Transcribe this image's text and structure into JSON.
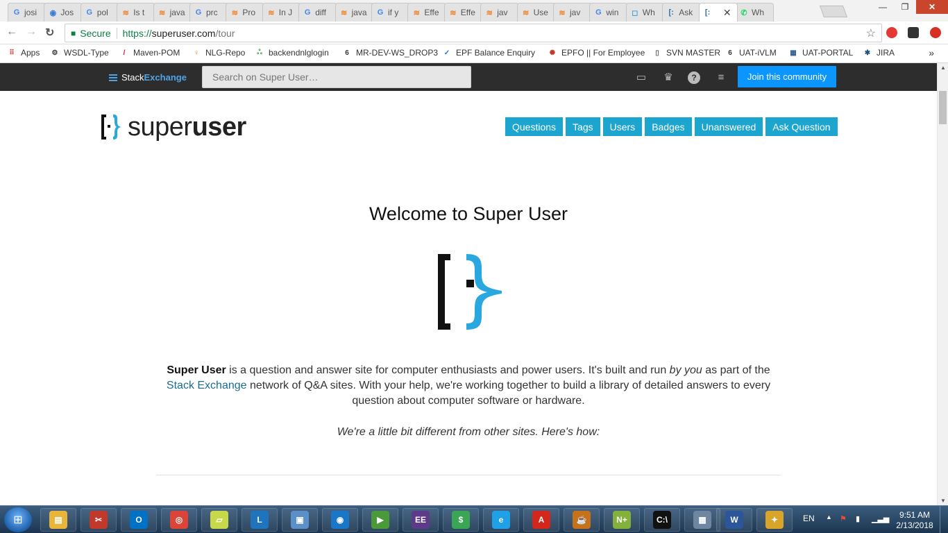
{
  "browser": {
    "tabs": [
      {
        "label": "josi",
        "icon": "google-icon",
        "glyph": "G",
        "color": "#4285f4"
      },
      {
        "label": "Jos",
        "icon": "globe-icon",
        "glyph": "◉",
        "color": "#3a7bd5"
      },
      {
        "label": "pol",
        "icon": "google-icon",
        "glyph": "G",
        "color": "#4285f4"
      },
      {
        "label": "Is t",
        "icon": "stackoverflow-icon",
        "glyph": "≋",
        "color": "#f48024"
      },
      {
        "label": "java",
        "icon": "stackoverflow-icon",
        "glyph": "≋",
        "color": "#f48024"
      },
      {
        "label": "prc",
        "icon": "google-icon",
        "glyph": "G",
        "color": "#4285f4"
      },
      {
        "label": "Pro",
        "icon": "stackoverflow-icon",
        "glyph": "≋",
        "color": "#f48024"
      },
      {
        "label": "In J",
        "icon": "stackoverflow-icon",
        "glyph": "≋",
        "color": "#f48024"
      },
      {
        "label": "diff",
        "icon": "google-icon",
        "glyph": "G",
        "color": "#4285f4"
      },
      {
        "label": "java",
        "icon": "stackoverflow-icon",
        "glyph": "≋",
        "color": "#f48024"
      },
      {
        "label": "if y",
        "icon": "google-icon",
        "glyph": "G",
        "color": "#4285f4"
      },
      {
        "label": "Effe",
        "icon": "stackoverflow-icon",
        "glyph": "≋",
        "color": "#f48024"
      },
      {
        "label": "Effe",
        "icon": "stackoverflow-icon",
        "glyph": "≋",
        "color": "#f48024"
      },
      {
        "label": "jav",
        "icon": "stackoverflow-icon",
        "glyph": "≋",
        "color": "#f48024"
      },
      {
        "label": "Use",
        "icon": "stackoverflow-icon",
        "glyph": "≋",
        "color": "#f48024"
      },
      {
        "label": "jav",
        "icon": "stackoverflow-icon",
        "glyph": "≋",
        "color": "#f48024"
      },
      {
        "label": "win",
        "icon": "google-icon",
        "glyph": "G",
        "color": "#4285f4"
      },
      {
        "label": "Wh",
        "icon": "chat-icon",
        "glyph": "◻",
        "color": "#4aa3df"
      },
      {
        "label": "Ask",
        "icon": "superuser-icon",
        "glyph": "[:",
        "color": "#2f6fa3"
      },
      {
        "label": "",
        "icon": "superuser-icon",
        "glyph": "[:",
        "color": "#2f6fa3",
        "active": true
      },
      {
        "label": "Wh",
        "icon": "whatsapp-icon",
        "glyph": "✆",
        "color": "#25d366"
      }
    ],
    "close_glyph": "✕",
    "window_controls": {
      "minimize": "—",
      "maximize": "❐",
      "close": "✕"
    },
    "nav": {
      "back": "←",
      "forward": "→",
      "reload": "↻"
    },
    "address": {
      "secure_label": "Secure",
      "scheme": "https://",
      "host": "superuser.com",
      "path": "/tour",
      "star": "☆"
    },
    "bookmarks": [
      {
        "label": "Apps",
        "icon": "apps-grid-icon",
        "glyph": "⠿",
        "color": "#d93025"
      },
      {
        "label": "WSDL-Type",
        "icon": "network-icon",
        "glyph": "⚙",
        "color": "#333333"
      },
      {
        "label": "Maven-POM",
        "icon": "maven-icon",
        "glyph": "/",
        "color": "#c71a36"
      },
      {
        "label": "NLG-Repo",
        "icon": "nexus-icon",
        "glyph": "♀",
        "color": "#e8710a"
      },
      {
        "label": "backendnlglogin",
        "icon": "users-icon",
        "glyph": "ஃ",
        "color": "#3a9b46"
      },
      {
        "label": "MR-DEV-WS_DROP3",
        "icon": "jboss-icon",
        "glyph": "6",
        "color": "#333333"
      },
      {
        "label": "EPF Balance Enquiry",
        "icon": "check-icon",
        "glyph": "✓",
        "color": "#1a73e8"
      },
      {
        "label": "EPFO || For Employee",
        "icon": "epfo-icon",
        "glyph": "✺",
        "color": "#c0392b"
      },
      {
        "label": "SVN MASTER",
        "icon": "page-icon",
        "glyph": "▯",
        "color": "#666666"
      },
      {
        "label": "UAT-iVLM",
        "icon": "jboss-icon",
        "glyph": "6",
        "color": "#333333"
      },
      {
        "label": "UAT-PORTAL",
        "icon": "portal-icon",
        "glyph": "▦",
        "color": "#2a5d8f"
      },
      {
        "label": "JIRA",
        "icon": "jira-icon",
        "glyph": "✱",
        "color": "#205081"
      }
    ],
    "bookmarks_more": "»"
  },
  "stackexchange_bar": {
    "brand_stack": "Stack",
    "brand_exchange": "Exchange",
    "search_placeholder": "Search on Super User…",
    "join_label": "Join this community"
  },
  "site": {
    "logo_super": "super",
    "logo_user": "user",
    "nav": [
      "Questions",
      "Tags",
      "Users",
      "Badges",
      "Unanswered",
      "Ask Question"
    ],
    "welcome": "Welcome to Super User",
    "intro": {
      "site_name": "Super User",
      "part1": " is a question and answer site for computer enthusiasts and power users. It's built and run ",
      "by_you": "by you",
      "part2": " as part of the ",
      "link": "Stack Exchange",
      "part3": " network of Q&A sites. With your help, we're working together to build a library of detailed answers to every question about computer software or hardware."
    },
    "different": "We're a little bit different from other sites. Here's how:",
    "accent": "#1ba5cf",
    "brand_blue": "#29a7df"
  },
  "taskbar": {
    "apps": [
      {
        "name": "file-explorer-icon",
        "glyph": "▤",
        "color": "#e8b43a"
      },
      {
        "name": "snipping-tool-icon",
        "glyph": "✂",
        "color": "#c0392b"
      },
      {
        "name": "outlook-icon",
        "glyph": "O",
        "color": "#0072c6"
      },
      {
        "name": "chrome-icon",
        "glyph": "◎",
        "color": "#db4437"
      },
      {
        "name": "sticky-notes-icon",
        "glyph": "▱",
        "color": "#c7d94a"
      },
      {
        "name": "lync-icon",
        "glyph": "L",
        "color": "#1e74bd"
      },
      {
        "name": "remote-desktop-icon",
        "glyph": "▣",
        "color": "#5b8fc7"
      },
      {
        "name": "wifi-icon",
        "glyph": "◉",
        "color": "#1877c9"
      },
      {
        "name": "media-player-icon",
        "glyph": "▶",
        "color": "#4a9a3a"
      },
      {
        "name": "javaee-icon",
        "glyph": "EE",
        "color": "#5d3a8a"
      },
      {
        "name": "money-icon",
        "glyph": "$",
        "color": "#3aa655"
      },
      {
        "name": "ie-icon",
        "glyph": "e",
        "color": "#1ea1e6"
      },
      {
        "name": "acrobat-icon",
        "glyph": "A",
        "color": "#d4271b"
      },
      {
        "name": "java-icon",
        "glyph": "☕",
        "color": "#c7721b"
      },
      {
        "name": "notepadpp-icon",
        "glyph": "N+",
        "color": "#84b03c"
      },
      {
        "name": "cmd-icon",
        "glyph": "C:\\",
        "color": "#111111"
      },
      {
        "name": "calculator-icon",
        "glyph": "▦",
        "color": "#6f86a0"
      },
      {
        "name": "word-icon",
        "glyph": "W",
        "color": "#2b579a"
      },
      {
        "name": "vpn-icon",
        "glyph": "✦",
        "color": "#d8a52a"
      }
    ],
    "lang": "EN",
    "tray_up": "▲",
    "time": "9:51 AM",
    "date": "2/13/2018"
  }
}
